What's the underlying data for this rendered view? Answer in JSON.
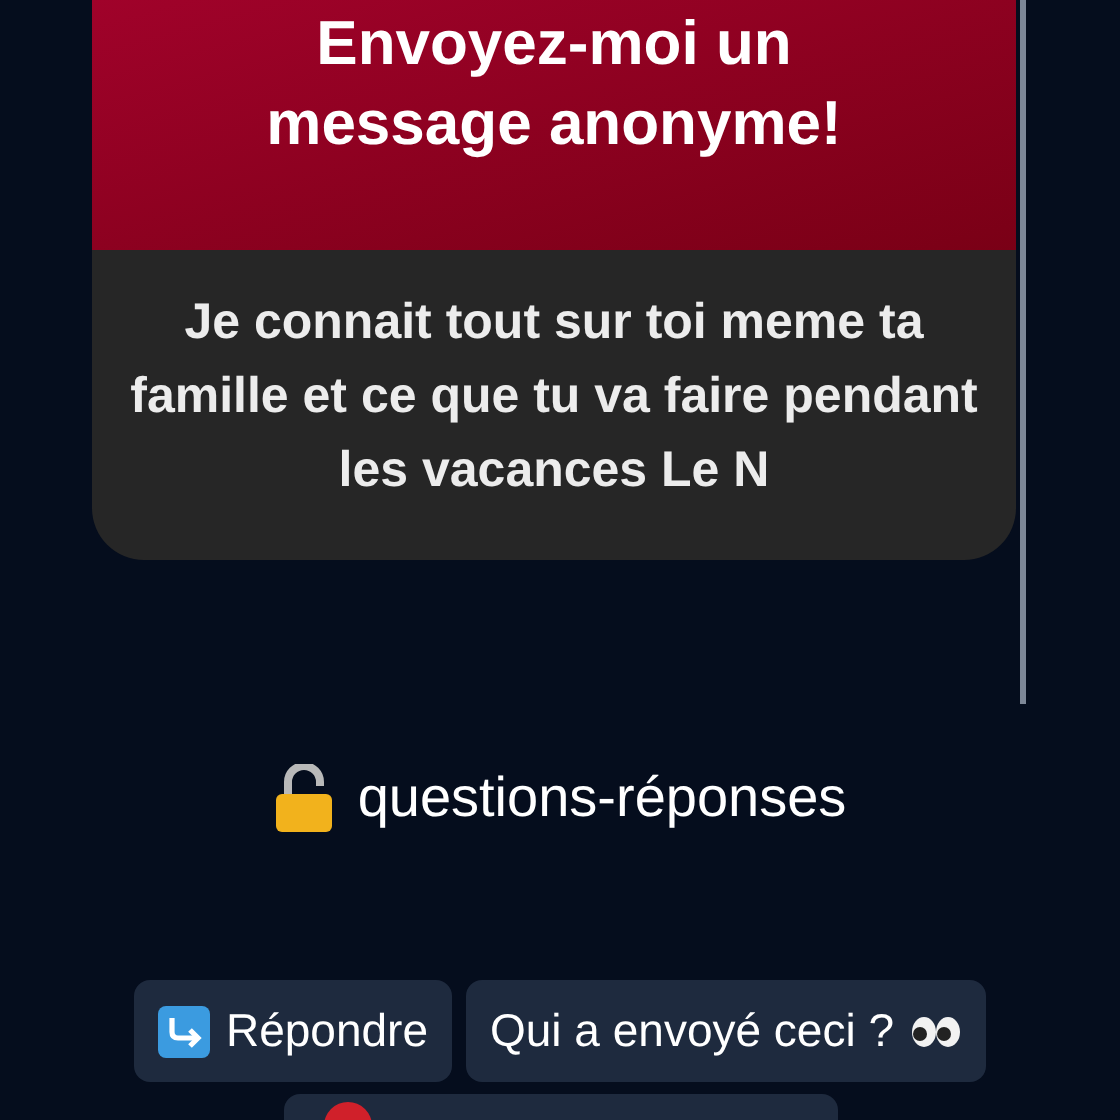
{
  "card": {
    "title": "Envoyez-moi un message anonyme!",
    "message": "Je connait tout sur toi meme ta famille et ce que tu va faire pendant les vacances Le N"
  },
  "caption": "questions-réponses",
  "buttons": [
    {
      "kind": "reply",
      "label": "Répondre"
    },
    {
      "kind": "who",
      "label": "Qui a envoyé ceci ?"
    },
    {
      "kind": "report"
    }
  ]
}
